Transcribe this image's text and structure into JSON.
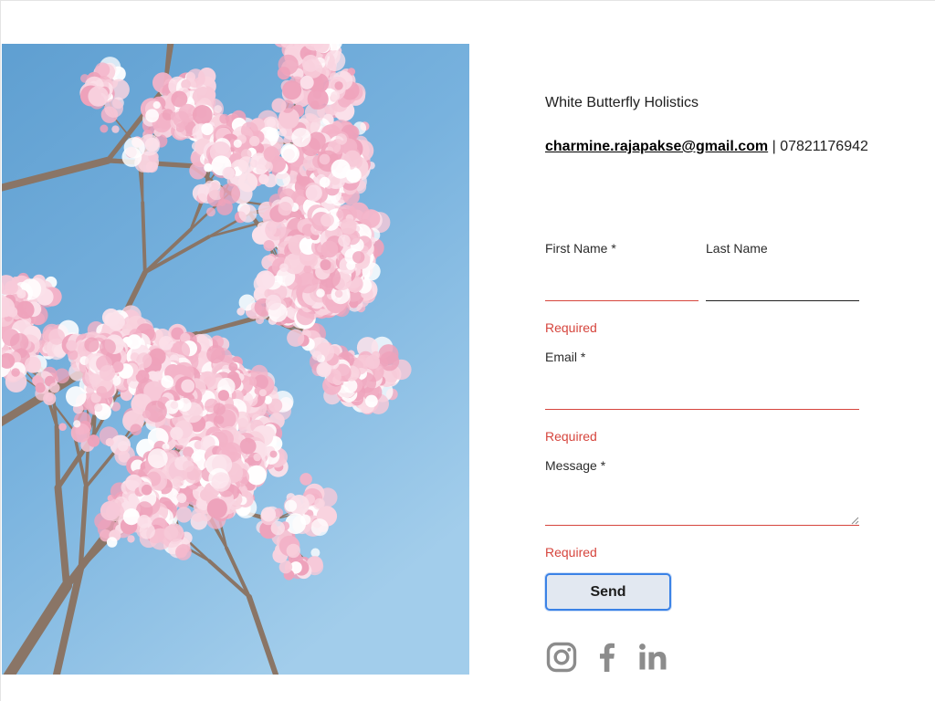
{
  "business": {
    "name": "White Butterfly Holistics",
    "email": "charmine.rajapakse@gmail.com",
    "separator": " | ",
    "phone": "07821176942"
  },
  "form": {
    "first_name_label": "First Name *",
    "last_name_label": "Last Name",
    "email_label": "Email *",
    "message_label": "Message *",
    "required_text": "Required",
    "send_label": "Send"
  },
  "hero_image": {
    "description": "pink-blossom-tree-against-blue-sky"
  },
  "social": [
    {
      "name": "instagram-icon"
    },
    {
      "name": "facebook-icon"
    },
    {
      "name": "linkedin-icon"
    }
  ],
  "colors": {
    "error": "#d6453d",
    "button_bg": "#e2e8f1",
    "button_border": "#3b82e6",
    "icon_gray": "#8c8c8c",
    "sky": "#7ab4de"
  }
}
